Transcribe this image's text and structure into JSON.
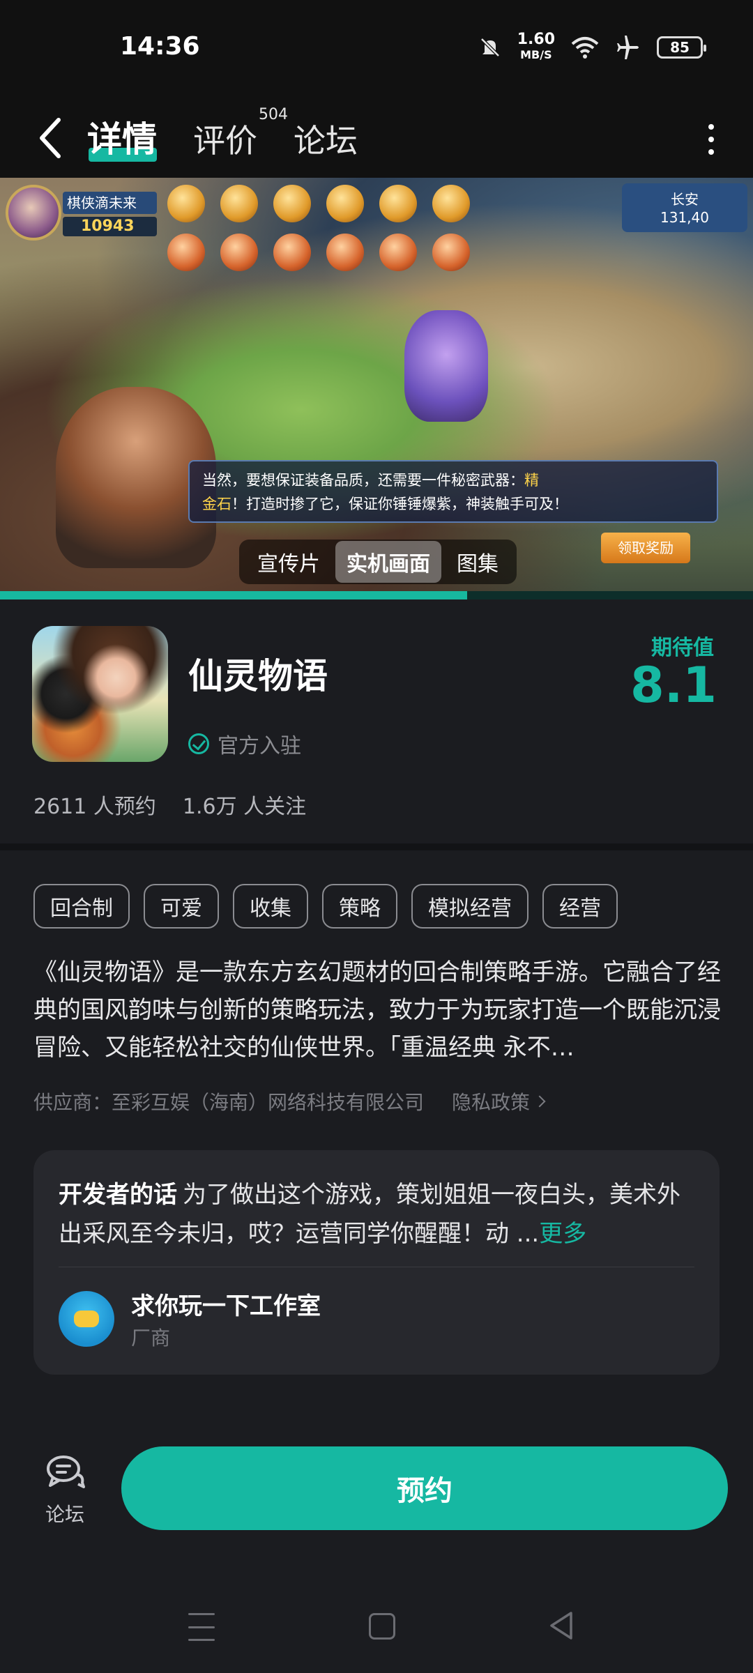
{
  "status": {
    "time": "14:36",
    "net_speed": "1.60",
    "net_unit": "MB/S",
    "battery": "85"
  },
  "nav": {
    "tabs": [
      {
        "label": "详情",
        "active": true
      },
      {
        "label": "评价",
        "badge": "504"
      },
      {
        "label": "论坛"
      }
    ]
  },
  "hero": {
    "player_name": "棋侠滴未来",
    "gold": "10943",
    "location": "长安",
    "coords": "131,40",
    "dialog_a": "当然，要想保证装备品质，还需要一件秘密武器：",
    "dialog_gold_a": "精",
    "dialog_gold_b": "金石",
    "dialog_b": "！打造时掺了它，保证你锤锤爆紫，神装触手可及！",
    "reward_button": "领取奖励",
    "media_tabs": [
      {
        "label": "宣传片",
        "active": false
      },
      {
        "label": "实机画面",
        "active": true
      },
      {
        "label": "图集",
        "active": false
      }
    ],
    "progress": 0.62
  },
  "app": {
    "title": "仙灵物语",
    "official": "官方入驻",
    "expect_label": "期待值",
    "expect_score": "8.1",
    "reservations": "2611 人预约",
    "followers": "1.6万 人关注"
  },
  "tags": [
    "回合制",
    "可爱",
    "收集",
    "策略",
    "模拟经营",
    "经营"
  ],
  "description": "《仙灵物语》是一款东方玄幻题材的回合制策略手游。它融合了经典的国风韵味与创新的策略玩法，致力于为玩家打造一个既能沉浸冒险、又能轻松社交的仙侠世界。「重温经典 永不…",
  "supplier": {
    "label": "供应商：至彩互娱（海南）网络科技有限公司",
    "privacy": "隐私政策"
  },
  "developer": {
    "heading": "开发者的话",
    "words": "为了做出这个游戏，策划姐姐一夜白头，美术外出采风至今未归，哎？运营同学你醒醒！动 ...",
    "more": "更多",
    "studio_name": "求你玩一下工作室",
    "studio_role": "厂商"
  },
  "bottom": {
    "forum_label": "论坛",
    "reserve_label": "预约"
  },
  "colors": {
    "accent": "#16b8a2",
    "background": "#1b1c20",
    "card": "#27282d"
  }
}
